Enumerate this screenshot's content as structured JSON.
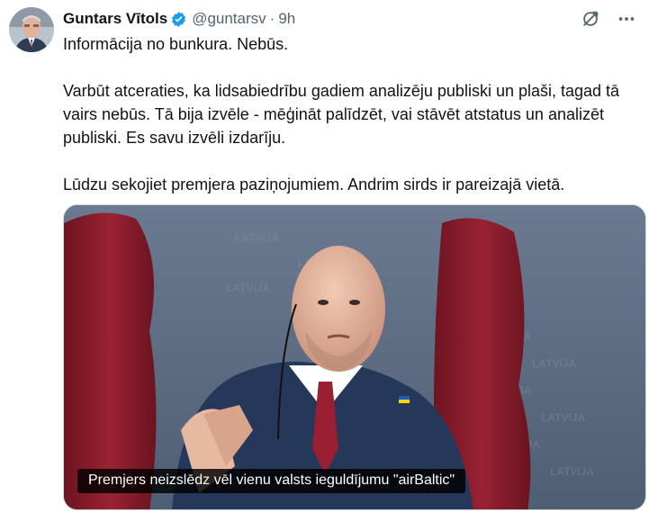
{
  "author": {
    "name": "Guntars Vītols",
    "handle": "@guntarsv",
    "separator": "·",
    "time": "9h",
    "verified": true,
    "avatar_icon": "avatar"
  },
  "icons": {
    "grok": "grok-icon",
    "more": "more-icon"
  },
  "tweet": {
    "paragraphs": [
      "Informācija no bunkura. Nebūs.",
      "Varbūt atceraties, ka lidsabiedrību gadiem analizēju publiski un plaši, tagad tā vairs nebūs. Tā bija izvēle - mēģināt palīdzēt, vai stāvēt atstatus un analizēt publiski. Es savu izvēli izdarīju.",
      "Lūdzu sekojiet premjera paziņojumiem. Andrim sirds ir pareizajā vietā."
    ]
  },
  "media": {
    "caption": "Premjers neizslēdz vēl vienu valsts ieguldījumu \"airBaltic\"",
    "background_text": "LATVIJA"
  },
  "colors": {
    "text": "#0f1419",
    "secondary": "#536471",
    "verified_blue": "#1d9bf0",
    "flag_red": "#8e1b2b"
  }
}
